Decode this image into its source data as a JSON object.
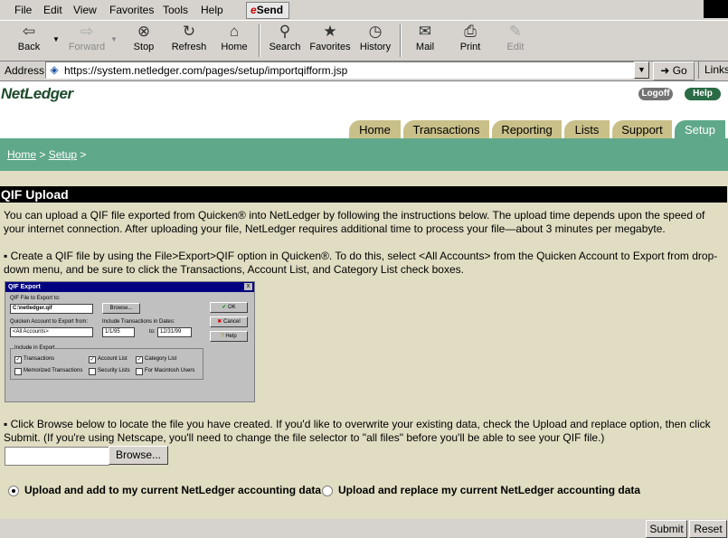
{
  "browser": {
    "menu": [
      "File",
      "Edit",
      "View",
      "Favorites",
      "Tools",
      "Help"
    ],
    "send_label": "Send",
    "toolbar": [
      {
        "label": "Back",
        "icon": "back-arrow-icon",
        "glyph": "⇦",
        "enabled": true
      },
      {
        "label": "Forward",
        "icon": "forward-arrow-icon",
        "glyph": "⇨",
        "enabled": false
      },
      {
        "label": "Stop",
        "icon": "stop-icon",
        "glyph": "⊗",
        "enabled": true
      },
      {
        "label": "Refresh",
        "icon": "refresh-icon",
        "glyph": "↻",
        "enabled": true
      },
      {
        "label": "Home",
        "icon": "home-icon",
        "glyph": "⌂",
        "enabled": true
      },
      {
        "label": "Search",
        "icon": "search-icon",
        "glyph": "⚲",
        "enabled": true
      },
      {
        "label": "Favorites",
        "icon": "favorites-icon",
        "glyph": "★",
        "enabled": true
      },
      {
        "label": "History",
        "icon": "history-icon",
        "glyph": "◷",
        "enabled": true
      },
      {
        "label": "Mail",
        "icon": "mail-icon",
        "glyph": "✉",
        "enabled": true
      },
      {
        "label": "Print",
        "icon": "print-icon",
        "glyph": "⎙",
        "enabled": true
      },
      {
        "label": "Edit",
        "icon": "edit-icon",
        "glyph": "✎",
        "enabled": false
      }
    ],
    "address_label": "Address",
    "url": "https://system.netledger.com/pages/setup/importqifform.jsp",
    "go_label": "Go",
    "links_label": "Links"
  },
  "site": {
    "logo": "NetLedger",
    "logoff_label": "Logoff",
    "help_label": "Help",
    "tabs": [
      {
        "label": "Home",
        "active": false
      },
      {
        "label": "Transactions",
        "active": false
      },
      {
        "label": "Reporting",
        "active": false
      },
      {
        "label": "Lists",
        "active": false
      },
      {
        "label": "Support",
        "active": false
      },
      {
        "label": "Setup",
        "active": true
      }
    ],
    "breadcrumb": {
      "home": "Home",
      "sep": ">",
      "setup": "Setup",
      "trail": ">"
    }
  },
  "page": {
    "title": "QIF Upload",
    "intro": "You can upload a QIF file exported from Quicken® into NetLedger by following the instructions below. The upload time depends upon the speed of your internet connection. After uploading your file, NetLedger requires additional time to process your file—about 3 minutes per megabyte.",
    "step1": "▪ Create a QIF file by using the File>Export>QIF option in Quicken®. To do this, select <All Accounts> from the Quicken Account to Export from drop-down menu, and be sure to click the Transactions, Account List, and Category List check boxes.",
    "step2": "▪ Click Browse below to locate the file you have created. If you'd like to overwrite your existing data, check the Upload and replace option, then click Submit. (If you're using Netscape, you'll need to change the file selector to \"all files\" before you'll be able to see your QIF file.)",
    "file_value": "",
    "browse_label": "Browse...",
    "option_add": "Upload and add to my current NetLedger accounting data",
    "option_replace": "Upload and replace my current NetLedger accounting data",
    "selected_option": "add"
  },
  "qif_dialog": {
    "title": "QIF Export",
    "close": "x",
    "file_label": "QIF File to Export to:",
    "file_value": "C:\\netledger.qif",
    "browse": "Browse...",
    "ok": "OK",
    "cancel": "Cancel",
    "help": "Help",
    "account_label": "Quicken Account to Export from:",
    "account_value": "<All Accounts>",
    "dates_label": "Include Transactions in Dates:",
    "date_from": "1/1/95",
    "date_to_label": "to:",
    "date_to": "12/31/99",
    "include_label": "Include in Export",
    "checks": [
      {
        "label": "Transactions",
        "checked": true
      },
      {
        "label": "Account List",
        "checked": true
      },
      {
        "label": "Category List",
        "checked": true
      },
      {
        "label": "Memorized Transactions",
        "checked": false
      },
      {
        "label": "Security Lists",
        "checked": false
      },
      {
        "label": "For Macintosh Users",
        "checked": false
      }
    ]
  },
  "footer": {
    "submit_label": "Submit",
    "reset_label": "Reset"
  },
  "colors": {
    "nav_green": "#60a88a",
    "tab_tan": "#c9c089",
    "content_bg": "#e0ddc2",
    "logo_green": "#2f6e43"
  }
}
